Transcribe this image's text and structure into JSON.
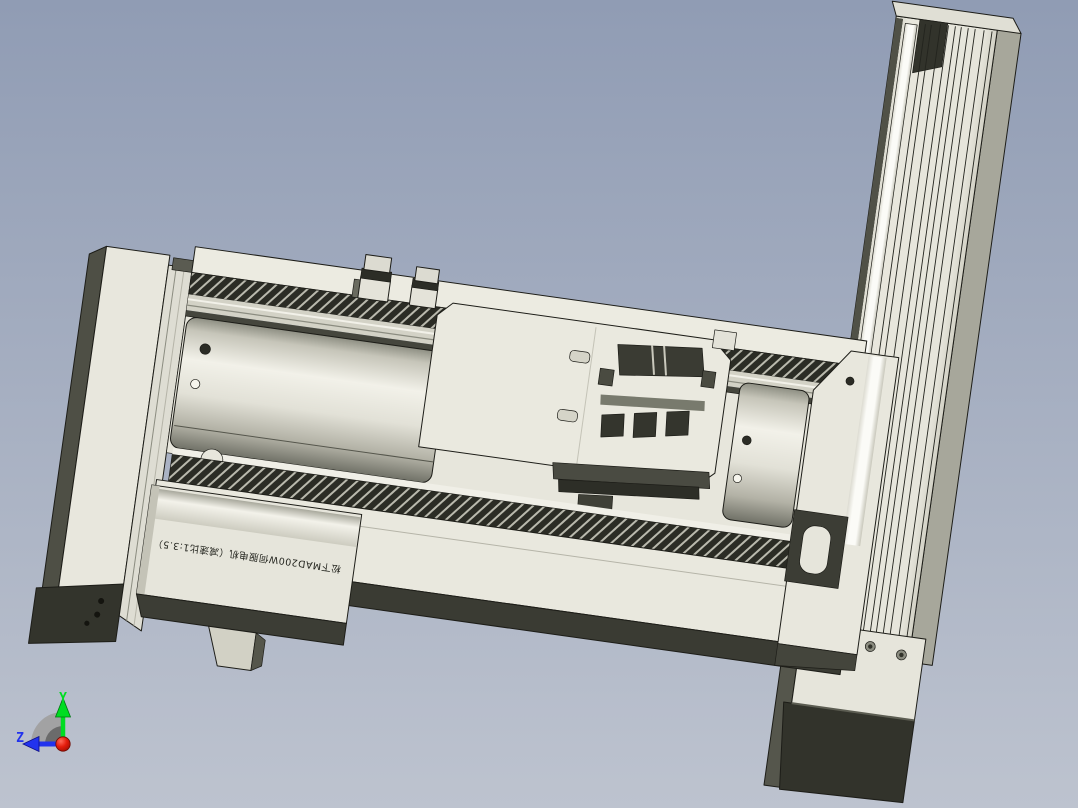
{
  "viewport": {
    "type": "3d-cad-viewport",
    "background_top": "#909cb4",
    "background_bottom": "#bdc3cf"
  },
  "model": {
    "description": "XZ gantry of two linear actuator modules",
    "motor_label": "松下MAD200W伺服电机（减速比1:3.5）",
    "colors": {
      "body_ivory": "#e7e6dc",
      "body_light": "#f2f1e9",
      "side_shade": "#a9a99d",
      "dark_face": "#3c3d35",
      "very_dark": "#2b2c25",
      "bright_rail": "#fbfbf7",
      "outline": "#1d1d18"
    }
  },
  "triad": {
    "y_axis": {
      "label": "Y",
      "color": "#00dd22"
    },
    "z_axis": {
      "label": "Z",
      "color": "#2233ee"
    },
    "origin_color": "#dd1111",
    "x_sector_color": "#9f9f9f"
  }
}
